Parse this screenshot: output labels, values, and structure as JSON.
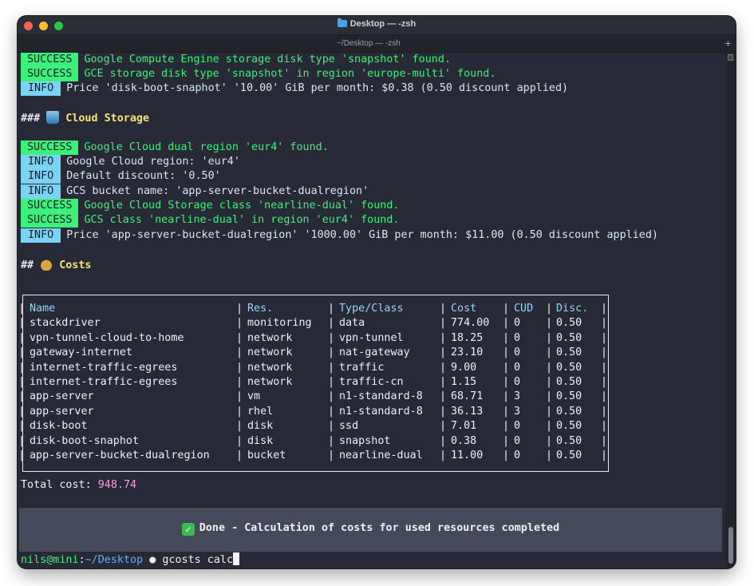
{
  "window": {
    "title": "Desktop — -zsh",
    "tab_title": "~/Desktop — -zsh",
    "new_tab_glyph": "+"
  },
  "log": {
    "line1": {
      "tag": "SUCCESS",
      "text": "Google Compute Engine storage disk type 'snapshot' found."
    },
    "line2": {
      "tag": "SUCCESS",
      "text": "GCE storage disk type 'snapshot' in region 'europe-multi' found."
    },
    "line3": {
      "tag": "INFO",
      "text": "Price 'disk-boot-snaphot' '10.00' GiB per month: $0.38 (0.50 discount applied)"
    },
    "section1": {
      "hash": "###",
      "icon": "wastebasket-icon",
      "title": "Cloud Storage"
    },
    "line4": {
      "tag": "SUCCESS",
      "text": "Google Cloud dual region 'eur4' found."
    },
    "line5": {
      "tag": "INFO",
      "text": "Google Cloud region: 'eur4'"
    },
    "line6": {
      "tag": "INFO",
      "text": "Default discount: '0.50'"
    },
    "line7": {
      "tag": "INFO",
      "text": "GCS bucket name: 'app-server-bucket-dualregion'"
    },
    "line8": {
      "tag": "SUCCESS",
      "text": "Google Cloud Storage class 'nearline-dual' found."
    },
    "line9": {
      "tag": "SUCCESS",
      "text": "GCS class 'nearline-dual' in region 'eur4' found."
    },
    "line10": {
      "tag": "INFO",
      "text": "Price 'app-server-bucket-dualregion' '1000.00' GiB per month: $11.00 (0.50 discount applied)"
    },
    "section2": {
      "hash": "##",
      "icon": "money-bag-icon",
      "title": "Costs"
    }
  },
  "table": {
    "headers": [
      "Name",
      "Res.",
      "Type/Class",
      "Cost",
      "CUD",
      "Disc."
    ],
    "rows": [
      [
        "stackdriver",
        "monitoring",
        "data",
        "774.00",
        "0",
        "0.50"
      ],
      [
        "vpn-tunnel-cloud-to-home",
        "network",
        "vpn-tunnel",
        "18.25",
        "0",
        "0.50"
      ],
      [
        "gateway-internet",
        "network",
        "nat-gateway",
        "23.10",
        "0",
        "0.50"
      ],
      [
        "internet-traffic-egrees",
        "network",
        "traffic",
        "9.00",
        "0",
        "0.50"
      ],
      [
        "internet-traffic-egrees",
        "network",
        "traffic-cn",
        "1.15",
        "0",
        "0.50"
      ],
      [
        "app-server",
        "vm",
        "n1-standard-8",
        "68.71",
        "3",
        "0.50"
      ],
      [
        "app-server",
        "rhel",
        "n1-standard-8",
        "36.13",
        "3",
        "0.50"
      ],
      [
        "disk-boot",
        "disk",
        "ssd",
        "7.01",
        "0",
        "0.50"
      ],
      [
        "disk-boot-snaphot",
        "disk",
        "snapshot",
        "0.38",
        "0",
        "0.50"
      ],
      [
        "app-server-bucket-dualregion",
        "bucket",
        "nearline-dual",
        "11.00",
        "0",
        "0.50"
      ]
    ]
  },
  "total": {
    "label": "Total cost:",
    "value": "948.74"
  },
  "done": {
    "icon": "check-mark-icon",
    "text": "Done - Calculation of costs for used resources completed"
  },
  "prompt": {
    "user": "nils@mini",
    "sep": ":",
    "path": "~/Desktop",
    "apple": "",
    "command": "gcosts calc"
  },
  "colors": {
    "success": "#3cf07a",
    "info": "#7ad3f5",
    "heading": "#f6e277",
    "total_value": "#ff9ee0",
    "background": "#272a36"
  }
}
